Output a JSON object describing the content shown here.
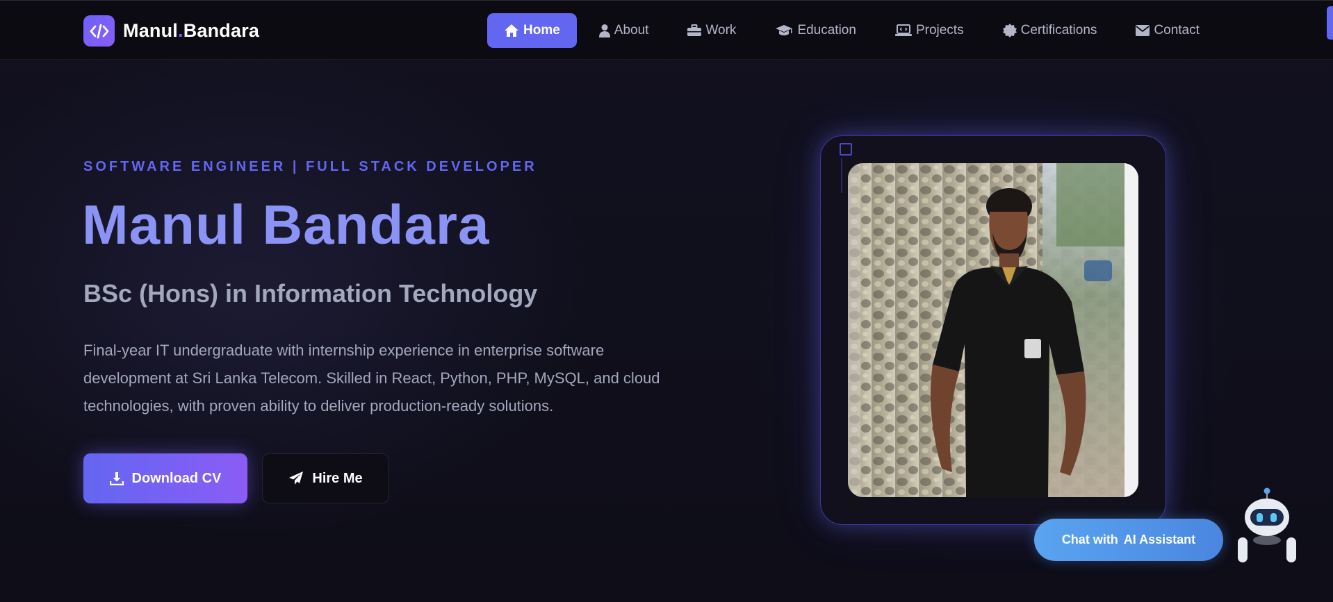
{
  "nav": {
    "brand_first": "Manul",
    "brand_dot": ".",
    "brand_last": "Bandara",
    "items": [
      {
        "label": "Home",
        "icon": "home-icon",
        "active": true
      },
      {
        "label": "About",
        "icon": "user-icon",
        "active": false
      },
      {
        "label": "Work",
        "icon": "briefcase-icon",
        "active": false
      },
      {
        "label": "Education",
        "icon": "graduation-cap-icon",
        "active": false
      },
      {
        "label": "Projects",
        "icon": "laptop-code-icon",
        "active": false
      },
      {
        "label": "Certifications",
        "icon": "certificate-icon",
        "active": false
      },
      {
        "label": "Contact",
        "icon": "envelope-icon",
        "active": false
      }
    ]
  },
  "hero": {
    "tagline": "SOFTWARE ENGINEER | FULL STACK DEVELOPER",
    "name": "Manul Bandara",
    "degree": "BSc (Hons) in Information Technology",
    "description": "Final-year IT undergraduate with internship experience in enterprise software development at Sri Lanka Telecom. Skilled in React, Python, PHP, MySQL, and cloud technologies, with proven ability to deliver production-ready solutions.",
    "download_cv_label": "Download CV",
    "hire_me_label": "Hire Me"
  },
  "chat": {
    "label_prefix": "Chat with",
    "label_highlight": "AI Assistant"
  },
  "colors": {
    "accent": "#6366f1",
    "name_gradient": "#8b93f5",
    "background": "#0e0d17",
    "chat": "#5aa4f0"
  }
}
